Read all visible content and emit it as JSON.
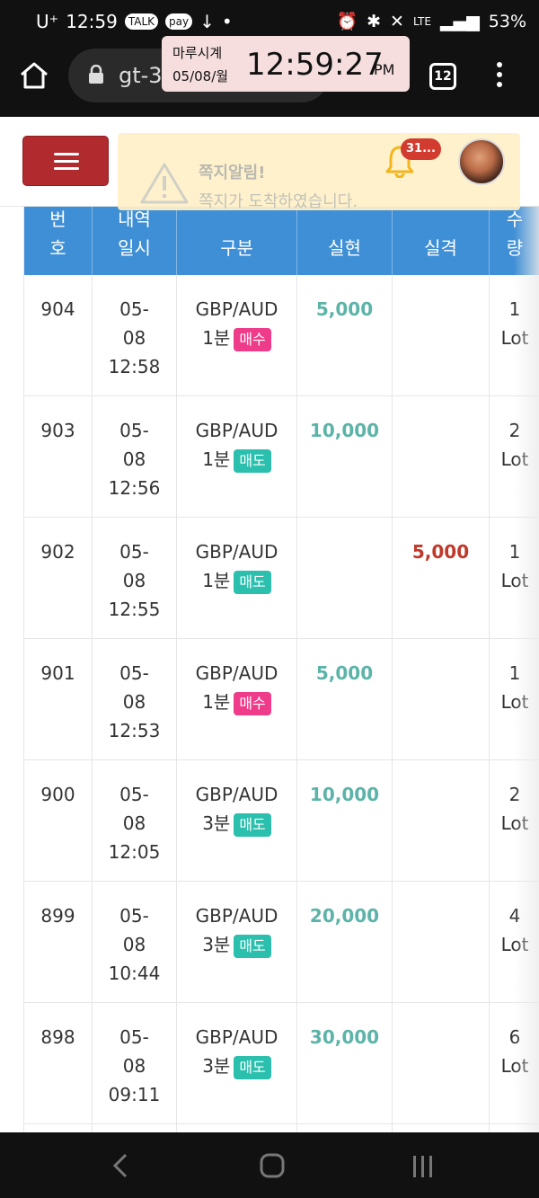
{
  "status_bar": {
    "carrier": "U⁺",
    "time": "12:59",
    "app_icons": [
      "TALK",
      "pay"
    ],
    "battery": "53%",
    "network": "LTE"
  },
  "clock_widget": {
    "title": "마루시계",
    "date": "05/08/월",
    "time": "12:59:27",
    "ampm": "PM"
  },
  "browser": {
    "url": "gt-36.../app/trak",
    "tab_count": "12"
  },
  "notice": {
    "title": "쪽지알림!",
    "body": "쪽지가 도착하였습니다.",
    "badge": "31..."
  },
  "table": {
    "headers": {
      "no": [
        "번",
        "호"
      ],
      "datetime": [
        "내역",
        "일시"
      ],
      "category": "구분",
      "profit": "실현",
      "loss": "실격",
      "qty": [
        "수",
        "량"
      ]
    },
    "rows": [
      {
        "no": "904",
        "date": [
          "05-",
          "08",
          "12:58"
        ],
        "pair": "GBP/AUD",
        "period": "1분",
        "side": "매수",
        "side_type": "buy",
        "profit": "5,000",
        "loss": "",
        "qty": [
          "1",
          "Lot"
        ]
      },
      {
        "no": "903",
        "date": [
          "05-",
          "08",
          "12:56"
        ],
        "pair": "GBP/AUD",
        "period": "1분",
        "side": "매도",
        "side_type": "sell",
        "profit": "10,000",
        "loss": "",
        "qty": [
          "2",
          "Lot"
        ]
      },
      {
        "no": "902",
        "date": [
          "05-",
          "08",
          "12:55"
        ],
        "pair": "GBP/AUD",
        "period": "1분",
        "side": "매도",
        "side_type": "sell",
        "profit": "",
        "loss": "5,000",
        "qty": [
          "1",
          "Lot"
        ]
      },
      {
        "no": "901",
        "date": [
          "05-",
          "08",
          "12:53"
        ],
        "pair": "GBP/AUD",
        "period": "1분",
        "side": "매수",
        "side_type": "buy",
        "profit": "5,000",
        "loss": "",
        "qty": [
          "1",
          "Lot"
        ]
      },
      {
        "no": "900",
        "date": [
          "05-",
          "08",
          "12:05"
        ],
        "pair": "GBP/AUD",
        "period": "3분",
        "side": "매도",
        "side_type": "sell",
        "profit": "10,000",
        "loss": "",
        "qty": [
          "2",
          "Lot"
        ]
      },
      {
        "no": "899",
        "date": [
          "05-",
          "08",
          "10:44"
        ],
        "pair": "GBP/AUD",
        "period": "3분",
        "side": "매도",
        "side_type": "sell",
        "profit": "20,000",
        "loss": "",
        "qty": [
          "4",
          "Lot"
        ]
      },
      {
        "no": "898",
        "date": [
          "05-",
          "08",
          "09:11"
        ],
        "pair": "GBP/AUD",
        "period": "3분",
        "side": "매도",
        "side_type": "sell",
        "profit": "30,000",
        "loss": "",
        "qty": [
          "6",
          "Lot"
        ]
      }
    ]
  },
  "colors": {
    "header_blue": "#3f8fd6",
    "menu_red": "#b02a2e",
    "profit": "#5cb3a8",
    "loss": "#c0392b",
    "buy": "#ee3c8a",
    "sell": "#2bbfae"
  }
}
